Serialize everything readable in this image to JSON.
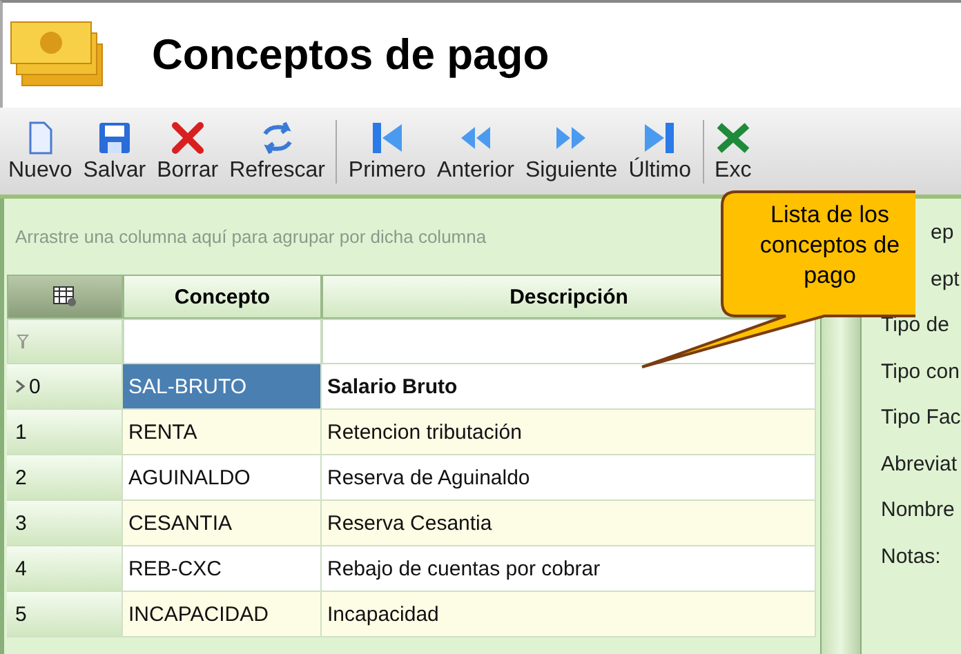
{
  "window": {
    "title": "Conceptos de pago"
  },
  "toolbar": {
    "groups": [
      [
        {
          "label": "Nuevo",
          "kind": "new"
        },
        {
          "label": "Salvar",
          "kind": "save"
        },
        {
          "label": "Borrar",
          "kind": "delete"
        },
        {
          "label": "Refrescar",
          "kind": "refresh"
        }
      ],
      [
        {
          "label": "Primero",
          "kind": "first"
        },
        {
          "label": "Anterior",
          "kind": "prev"
        },
        {
          "label": "Siguiente",
          "kind": "next"
        },
        {
          "label": "Último",
          "kind": "last"
        }
      ],
      [
        {
          "label": "Exc",
          "kind": "excel"
        }
      ]
    ]
  },
  "group_panel": {
    "hint": "Arrastre una columna aquí para agrupar por dicha columna"
  },
  "table": {
    "columns": [
      "Concepto",
      "Descripción"
    ],
    "rows": [
      {
        "index": "0",
        "concepto": "SAL-BRUTO",
        "descripcion": "Salario Bruto",
        "selected": true
      },
      {
        "index": "1",
        "concepto": "RENTA",
        "descripcion": "Retencion tributación",
        "selected": false
      },
      {
        "index": "2",
        "concepto": "AGUINALDO",
        "descripcion": "Reserva de Aguinaldo",
        "selected": false
      },
      {
        "index": "3",
        "concepto": "CESANTIA",
        "descripcion": "Reserva Cesantia",
        "selected": false
      },
      {
        "index": "4",
        "concepto": "REB-CXC",
        "descripcion": "Rebajo de cuentas por cobrar",
        "selected": false
      },
      {
        "index": "5",
        "concepto": "INCAPACIDAD",
        "descripcion": "Incapacidad",
        "selected": false
      }
    ]
  },
  "detail_panel": {
    "labels": [
      "ep",
      "ept",
      "Tipo de",
      "Tipo con",
      "Tipo Fac",
      "Abreviat",
      "Nombre",
      "Notas:"
    ]
  },
  "callout": {
    "text": "Lista de los conceptos de pago"
  }
}
